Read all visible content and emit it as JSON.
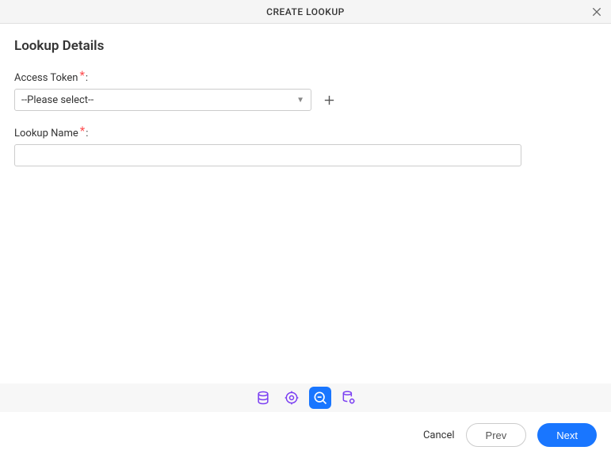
{
  "header": {
    "title": "CREATE LOOKUP"
  },
  "section": {
    "title": "Lookup Details"
  },
  "fields": {
    "accessToken": {
      "label": "Access Token",
      "colon": ":",
      "placeholder": "--Please select--",
      "value": ""
    },
    "lookupName": {
      "label": "Lookup Name",
      "colon": ":",
      "value": ""
    }
  },
  "footer": {
    "cancel": "Cancel",
    "prev": "Prev",
    "next": "Next"
  },
  "stepper": {
    "steps": [
      "data-source",
      "configure",
      "lookup-details",
      "data-settings"
    ],
    "activeIndex": 2
  }
}
